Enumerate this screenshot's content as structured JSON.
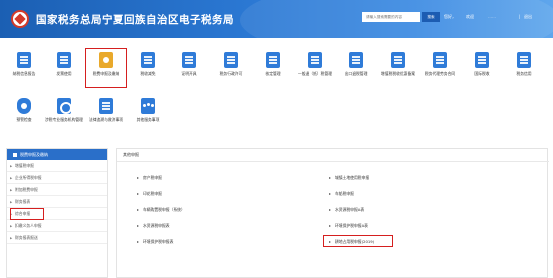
{
  "header": {
    "title": "国家税务总局宁夏回族自治区电子税务局",
    "search_placeholder": "请输入搜索需要的内容",
    "search_button": "搜索",
    "greeting": "您好，",
    "user_name": "欢迎",
    "user_extra": "……",
    "separator": "|",
    "logout": "退出"
  },
  "menu": {
    "row1": [
      {
        "label": "纳税信息报告",
        "icon": "document-icon"
      },
      {
        "label": "发票使用",
        "icon": "invoice-icon"
      },
      {
        "label": "税费申报及缴纳",
        "icon": "tax-declare-icon"
      },
      {
        "label": "税收减免",
        "icon": "reduction-icon"
      },
      {
        "label": "证明开具",
        "icon": "certificate-icon"
      },
      {
        "label": "税务行政许可",
        "icon": "license-icon"
      },
      {
        "label": "核定管理",
        "icon": "verify-icon"
      },
      {
        "label": "一般退（抵）税管理",
        "icon": "refund-icon"
      },
      {
        "label": "出口退税管理",
        "icon": "export-icon"
      },
      {
        "label": "增值税税收优惠备案",
        "icon": "vat-icon"
      },
      {
        "label": "税务代理劳务合同",
        "icon": "contract-icon"
      },
      {
        "label": "国际税收",
        "icon": "global-icon"
      },
      {
        "label": "税务信用",
        "icon": "credit-icon"
      }
    ],
    "row2": [
      {
        "label": "预警检查",
        "icon": "shield-icon"
      },
      {
        "label": "涉税专业服务机构管理",
        "icon": "gear-icon"
      },
      {
        "label": "法律追溯与救济事项",
        "icon": "law-icon"
      },
      {
        "label": "其他服务事项",
        "icon": "group-icon"
      }
    ]
  },
  "sidebar": {
    "title": "税费申报及缴纳",
    "items": [
      {
        "label": "增值税申报"
      },
      {
        "label": "企业所得税申报"
      },
      {
        "label": "附加税费申报"
      },
      {
        "label": "财务报表"
      },
      {
        "label": "综合申报"
      },
      {
        "label": "扣缴义务人申报"
      },
      {
        "label": "财务报表报送"
      }
    ]
  },
  "content": {
    "title": "其他申报",
    "left_items": [
      {
        "label": "房产税申报"
      },
      {
        "label": "印花税申报"
      },
      {
        "label": "车辆购置税申报（系统）"
      },
      {
        "label": "水资源税申报表"
      },
      {
        "label": "环境保护税申报表"
      }
    ],
    "right_items": [
      {
        "label": "城镇土地使用税申报"
      },
      {
        "label": "车船税申报"
      },
      {
        "label": "水资源税申报A表"
      },
      {
        "label": "环境保护税申报A表"
      },
      {
        "label": "耕地占用税申报(2019)"
      }
    ]
  },
  "colors": {
    "header_blue": "#2b78d3",
    "icon_blue": "#2f7bd8",
    "icon_yellow": "#e9a92b",
    "highlight_red": "#d51f1f",
    "sidebar_head": "#2a6fc9"
  }
}
